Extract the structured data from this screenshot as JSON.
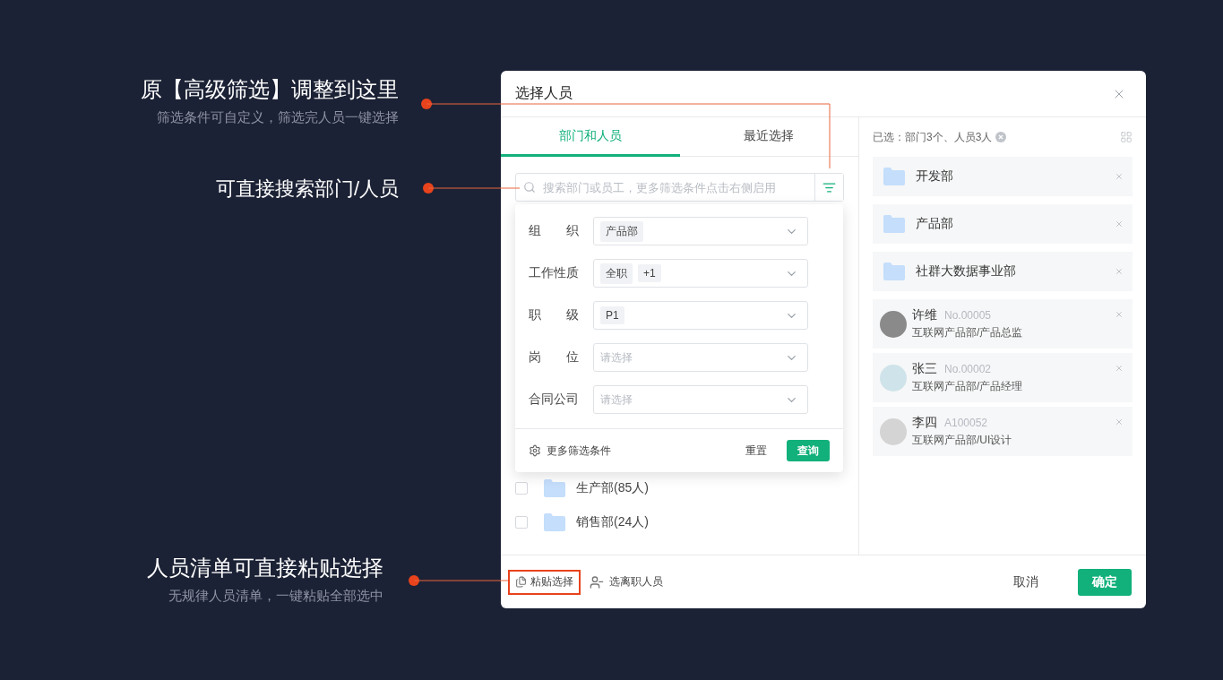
{
  "annotations": [
    {
      "title": "原【高级筛选】调整到这里",
      "subtitle": "筛选条件可自定义，筛选完人员一键选择"
    },
    {
      "title": "可直接搜索部门/人员"
    },
    {
      "title": "人员清单可直接粘贴选择",
      "subtitle": "无规律人员清单，一键粘贴全部选中"
    }
  ],
  "dialog": {
    "title": "选择人员",
    "tabs": [
      {
        "label": "部门和人员",
        "selected": true
      },
      {
        "label": "最近选择",
        "selected": false
      }
    ],
    "search": {
      "placeholder": "搜索部门或员工，更多筛选条件点击右侧启用"
    },
    "filter_panel": {
      "fields": [
        {
          "label": "组织",
          "tags": [
            "产品部"
          ]
        },
        {
          "label": "工作性质",
          "tags": [
            "全职",
            "+1"
          ]
        },
        {
          "label": "职级",
          "tags": [
            "P1"
          ]
        },
        {
          "label": "岗位",
          "placeholder": "请选择"
        },
        {
          "label": "合同公司",
          "placeholder": "请选择"
        }
      ],
      "more_link": "更多筛选条件",
      "reset_button": "重置",
      "query_button": "查询"
    },
    "departments": [
      {
        "name": "生产部(85人)",
        "checked": false
      },
      {
        "name": "销售部(24人)",
        "checked": false
      }
    ],
    "selected_panel": {
      "summary": "已选：部门3个、人员3人",
      "items": [
        {
          "kind": "department",
          "name": "开发部"
        },
        {
          "kind": "department",
          "name": "产品部"
        },
        {
          "kind": "department",
          "name": "社群大数据事业部"
        },
        {
          "kind": "person",
          "name": "许维",
          "id": "No.00005",
          "position": "互联网产品部/产品总监"
        },
        {
          "kind": "person",
          "name": "张三",
          "id": "No.00002",
          "position": "互联网产品部/产品经理"
        },
        {
          "kind": "person",
          "name": "李四",
          "id": "A100052",
          "position": "互联网产品部/UI设计"
        }
      ]
    },
    "footer": {
      "paste_button": "粘贴选择",
      "resigned_button": "选离职人员",
      "cancel_button": "取消",
      "confirm_button": "确定"
    }
  }
}
